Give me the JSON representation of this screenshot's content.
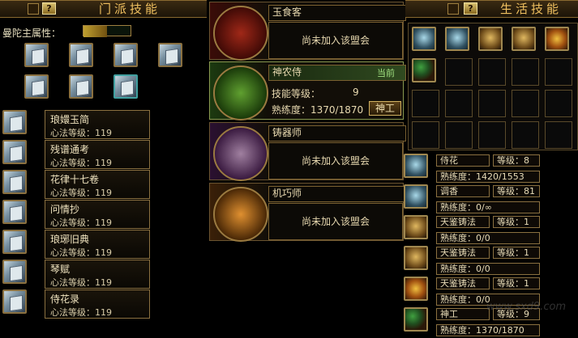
{
  "left_panel": {
    "title": "门派技能",
    "help_label": "?",
    "attribute_label": "曼陀主属性：",
    "skills": [
      {
        "name": "琅嬛玉简",
        "level": "心法等级：119"
      },
      {
        "name": "残谱通考",
        "level": "心法等级：119"
      },
      {
        "name": "花律十七卷",
        "level": "心法等级：119"
      },
      {
        "name": "问情抄",
        "level": "心法等级：119"
      },
      {
        "name": "琅琊旧典",
        "level": "心法等级：119"
      },
      {
        "name": "琴赋",
        "level": "心法等级：119"
      },
      {
        "name": "侍花录",
        "level": "心法等级：119"
      }
    ]
  },
  "middle_panel": {
    "alliances": [
      {
        "name": "玉食客",
        "status": "尚未加入该盟会"
      },
      {
        "name": "神农侍",
        "tag": "当前",
        "skill_level_label": "技能等级：",
        "skill_level_value": "9",
        "proficiency": "熟练度：1370/1870",
        "button": "神工"
      },
      {
        "name": "铸器师",
        "status": "尚未加入该盟会"
      },
      {
        "name": "机巧师",
        "status": "尚未加入该盟会"
      }
    ]
  },
  "right_panel": {
    "title": "生活技能",
    "help_label": "?",
    "skills": [
      {
        "name": "侍花",
        "level": "等级：8",
        "proficiency": "熟练度：1420/1553"
      },
      {
        "name": "调香",
        "level": "等级：81",
        "proficiency": "熟练度：0/∞"
      },
      {
        "name": "天鉴铸法",
        "level": "等级：1",
        "proficiency": "熟练度：0/0"
      },
      {
        "name": "天鉴铸法",
        "level": "等级：1",
        "proficiency": "熟练度：0/0"
      },
      {
        "name": "天鉴铸法",
        "level": "等级：1",
        "proficiency": "熟练度：0/0"
      },
      {
        "name": "神工",
        "level": "等级：9",
        "proficiency": "熟练度：1370/1870"
      }
    ]
  },
  "watermark": "www.sxd9.com",
  "colors": {
    "gold": "#f0c060",
    "border": "#8a7040",
    "background": "#000000"
  }
}
